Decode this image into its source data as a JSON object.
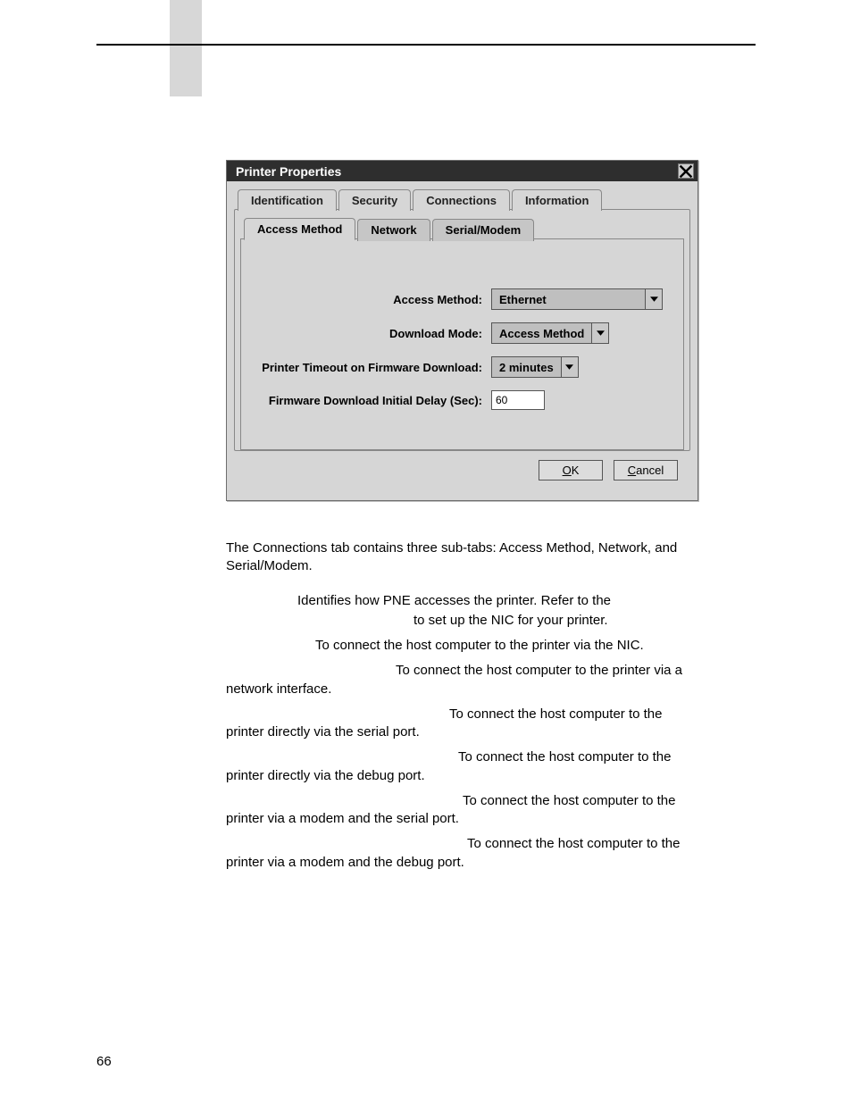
{
  "page_number": "66",
  "dialog": {
    "title": "Printer Properties",
    "close_symbol": "×",
    "tabs_top": [
      "Identification",
      "Security",
      "Connections",
      "Information"
    ],
    "tabs_sub": [
      "Access Method",
      "Network",
      "Serial/Modem"
    ],
    "form": {
      "access_method_label": "Access Method:",
      "access_method_value": "Ethernet",
      "download_mode_label": "Download Mode:",
      "download_mode_value": "Access Method",
      "timeout_label": "Printer Timeout on Firmware Download:",
      "timeout_value": "2 minutes",
      "initial_delay_label": "Firmware Download Initial Delay (Sec):",
      "initial_delay_value": "60"
    },
    "ok_label": "OK",
    "cancel_label": "Cancel"
  },
  "text": {
    "para1": "The Connections tab contains three sub-tabs: Access Method, Network, and Serial/Modem.",
    "line1a": "Identifies how PNE accesses the printer. Refer to the",
    "line1b": "to set up the NIC for your printer.",
    "line2": "To connect the host computer to the printer via the NIC.",
    "line3a": "To connect the host computer to the printer via a",
    "line3b": "network interface.",
    "line4a": "To connect the host computer to the",
    "line4b": "printer directly via the serial port.",
    "line5a": "To connect the host computer to the",
    "line5b": "printer directly via the debug port.",
    "line6a": "To connect the host computer to the",
    "line6b": "printer via a modem and the serial port.",
    "line7a": "To connect the host computer to the",
    "line7b": "printer via a modem and the debug port."
  }
}
